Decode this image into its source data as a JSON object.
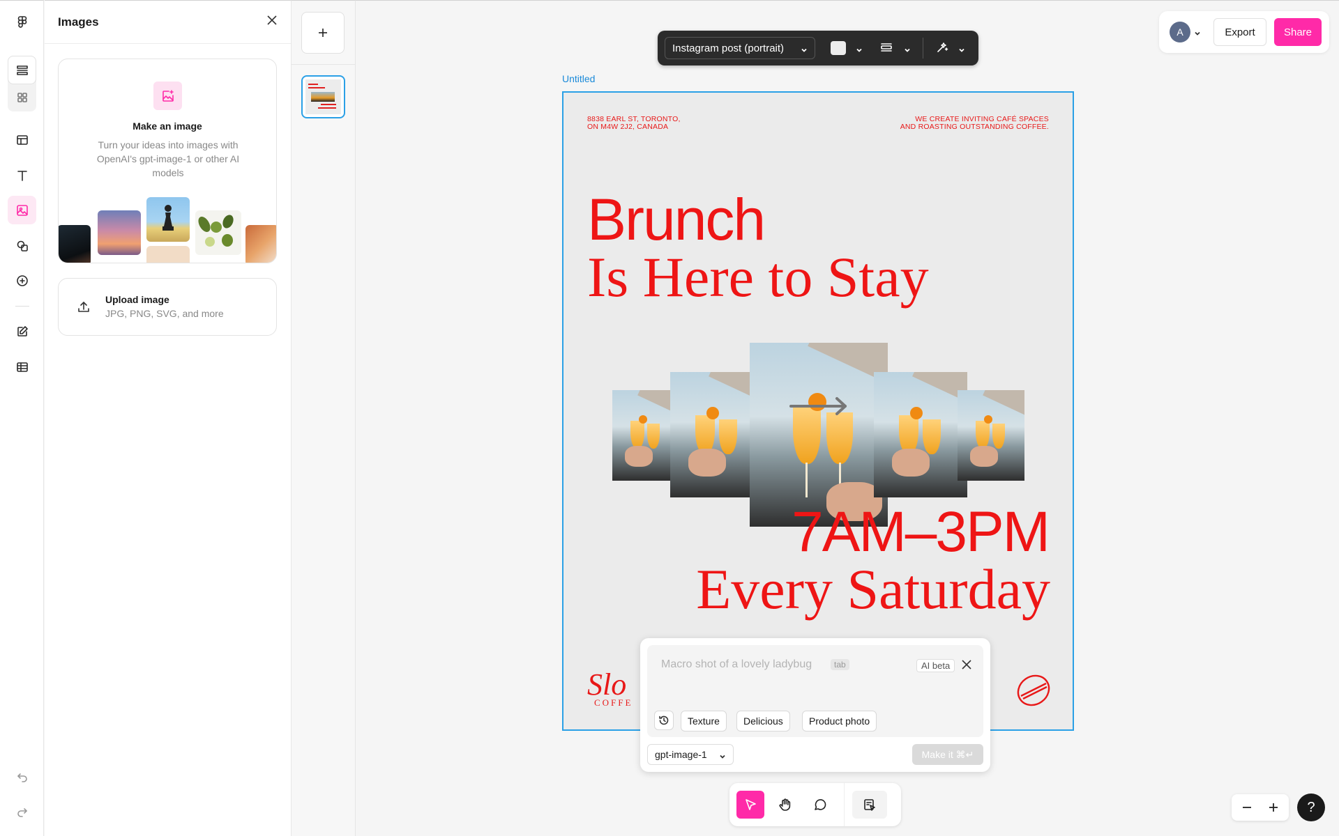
{
  "rail": {
    "icons": [
      "figma-logo-icon",
      "layers-icon",
      "grid-icon",
      "layout-icon",
      "text-icon",
      "image-icon",
      "shapes-icon",
      "add-circle-icon",
      "edit-icon",
      "table-icon",
      "undo-icon",
      "redo-icon"
    ],
    "active": "image-icon"
  },
  "panel": {
    "title": "Images",
    "make": {
      "title": "Make an image",
      "description": "Turn your ideas into images with OpenAI's gpt-image-1 or other AI models"
    },
    "upload": {
      "title": "Upload image",
      "subtitle": "JPG, PNG, SVG, and more"
    }
  },
  "topright": {
    "avatar_initial": "A",
    "export_label": "Export",
    "share_label": "Share",
    "accent": "#ff2aa8"
  },
  "toolbar": {
    "preset": "Instagram post (portrait)"
  },
  "artboard": {
    "name": "Untitled",
    "address_line1": "8838 EARL ST, TORONTO,",
    "address_line2": "ON M4W 2J2, CANADA",
    "tagline_line1": "WE CREATE INVITING CAFÉ SPACES",
    "tagline_line2": "AND ROASTING OUTSTANDING COFFEE.",
    "headline1": "Brunch",
    "headline2": "Is Here to Stay",
    "hours": "7AM–3PM",
    "day": "Every Saturday",
    "logo_text": "Slo",
    "logo_sub": "COFFE",
    "text_color": "#ee1515"
  },
  "prompt": {
    "placeholder": "Macro shot of a lovely ladybug",
    "tab_hint": "tab",
    "beta_label": "AI beta",
    "chips": [
      "Texture",
      "Delicious",
      "Product photo"
    ],
    "model": "gpt-image-1",
    "make_label": "Make it ⌘↵"
  },
  "help": {
    "label": "?"
  }
}
